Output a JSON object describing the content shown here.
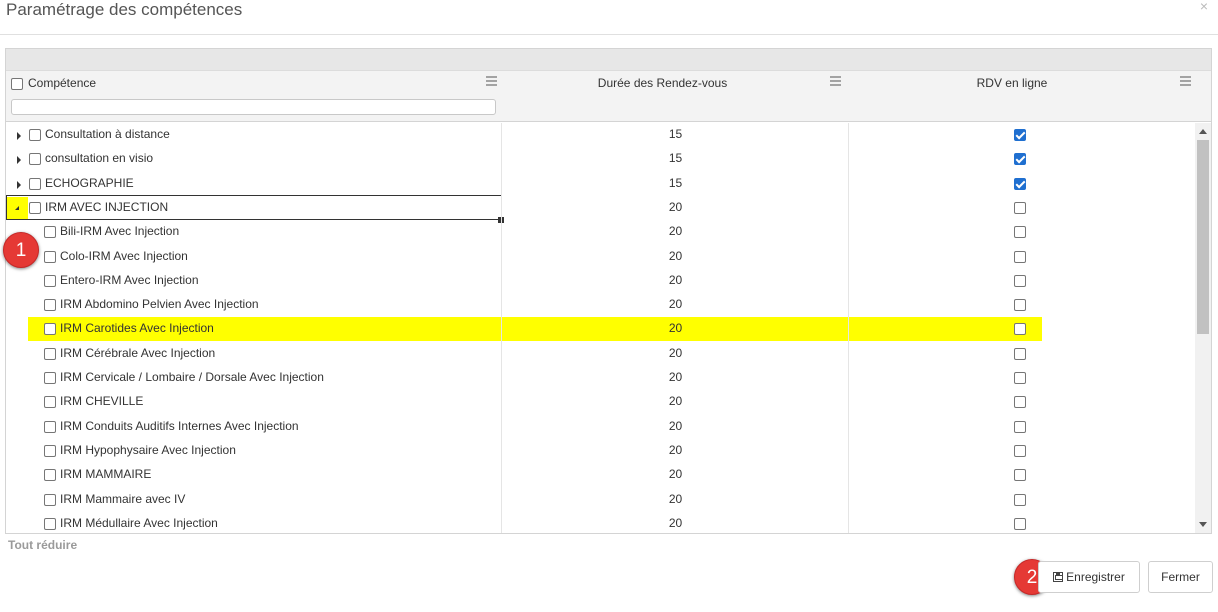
{
  "dialog": {
    "title": "Paramétrage des compétences",
    "close_glyph": "×"
  },
  "columns": {
    "competence": "Compétence",
    "duration": "Durée des Rendez-vous",
    "online": "RDV en ligne"
  },
  "filter": {
    "placeholder": ""
  },
  "rows": [
    {
      "label": "Consultation à distance",
      "duration": "15",
      "online": true,
      "level": 0,
      "expander": "collapsed"
    },
    {
      "label": "consultation en visio",
      "duration": "15",
      "online": true,
      "level": 0,
      "expander": "collapsed"
    },
    {
      "label": "ECHOGRAPHIE",
      "duration": "15",
      "online": true,
      "level": 0,
      "expander": "collapsed"
    },
    {
      "label": "IRM AVEC INJECTION",
      "duration": "20",
      "online": false,
      "level": 0,
      "expander": "expanded"
    },
    {
      "label": "Bili-IRM Avec Injection",
      "duration": "20",
      "online": false,
      "level": 1
    },
    {
      "label": "Colo-IRM Avec Injection",
      "duration": "20",
      "online": false,
      "level": 1
    },
    {
      "label": "Entero-IRM Avec Injection",
      "duration": "20",
      "online": false,
      "level": 1
    },
    {
      "label": "IRM Abdomino Pelvien Avec Injection",
      "duration": "20",
      "online": false,
      "level": 1
    },
    {
      "label": "IRM Carotides Avec Injection",
      "duration": "20",
      "online": false,
      "level": 1,
      "highlight": true
    },
    {
      "label": "IRM Cérébrale Avec Injection",
      "duration": "20",
      "online": false,
      "level": 1
    },
    {
      "label": "IRM Cervicale / Lombaire / Dorsale Avec Injection",
      "duration": "20",
      "online": false,
      "level": 1
    },
    {
      "label": "IRM CHEVILLE",
      "duration": "20",
      "online": false,
      "level": 1
    },
    {
      "label": "IRM Conduits Auditifs Internes Avec Injection",
      "duration": "20",
      "online": false,
      "level": 1
    },
    {
      "label": "IRM Hypophysaire Avec Injection",
      "duration": "20",
      "online": false,
      "level": 1
    },
    {
      "label": "IRM MAMMAIRE",
      "duration": "20",
      "online": false,
      "level": 1
    },
    {
      "label": "IRM Mammaire avec IV",
      "duration": "20",
      "online": false,
      "level": 1
    },
    {
      "label": "IRM Médullaire Avec Injection",
      "duration": "20",
      "online": false,
      "level": 1
    }
  ],
  "collapse_all": "Tout réduire",
  "badges": {
    "one": "1",
    "two": "2"
  },
  "buttons": {
    "save": "Enregistrer",
    "close": "Fermer"
  },
  "colors": {
    "highlight": "#ffff00",
    "badge": "#e53935",
    "checkbox_checked": "#1f6fd0"
  }
}
